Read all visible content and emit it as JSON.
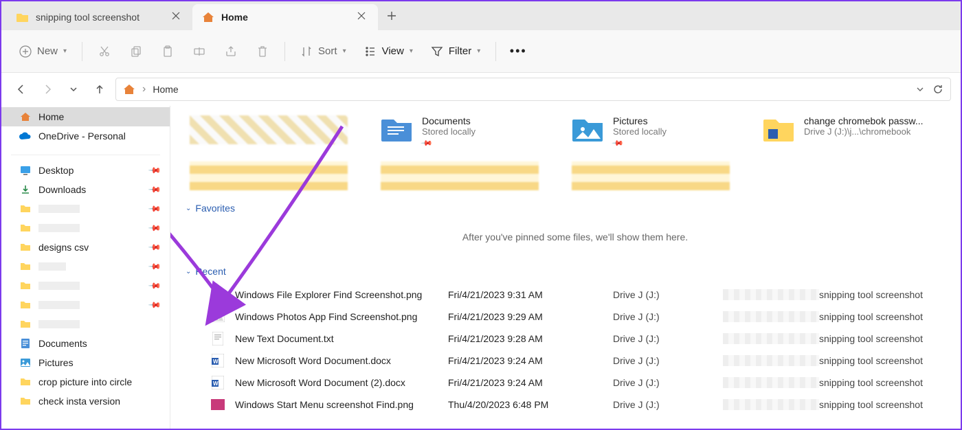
{
  "tabs": [
    {
      "label": "snipping tool screenshot",
      "active": false
    },
    {
      "label": "Home",
      "active": true
    }
  ],
  "toolbar": {
    "new": "New",
    "sort": "Sort",
    "view": "View",
    "filter": "Filter"
  },
  "breadcrumb": {
    "current": "Home",
    "sep": "›"
  },
  "sidebar": {
    "home": "Home",
    "onedrive": "OneDrive - Personal",
    "desktop": "Desktop",
    "downloads": "Downloads",
    "designs_csv": "designs csv",
    "documents": "Documents",
    "pictures": "Pictures",
    "crop": "crop picture into circle",
    "check_insta": "check insta version"
  },
  "quick": {
    "documents": {
      "title": "Documents",
      "sub": "Stored locally"
    },
    "pictures": {
      "title": "Pictures",
      "sub": "Stored locally"
    },
    "chromebook": {
      "title": "change chromebok passw...",
      "sub": "Drive J (J:)\\j...\\chromebook"
    }
  },
  "sections": {
    "favorites": "Favorites",
    "fav_empty": "After you've pinned some files, we'll show them here.",
    "recent": "Recent"
  },
  "recent": [
    {
      "name": "Windows File Explorer Find Screenshot.png",
      "date": "Fri/4/21/2023 9:31 AM",
      "loc": "Drive J (J:)",
      "path": "snipping tool screenshot",
      "icon": "img"
    },
    {
      "name": "Windows Photos App Find Screenshot.png",
      "date": "Fri/4/21/2023 9:29 AM",
      "loc": "Drive J (J:)",
      "path": "snipping tool screenshot",
      "icon": "img"
    },
    {
      "name": "New Text Document.txt",
      "date": "Fri/4/21/2023 9:28 AM",
      "loc": "Drive J (J:)",
      "path": "snipping tool screenshot",
      "icon": "txt"
    },
    {
      "name": "New Microsoft Word Document.docx",
      "date": "Fri/4/21/2023 9:24 AM",
      "loc": "Drive J (J:)",
      "path": "snipping tool screenshot",
      "icon": "doc"
    },
    {
      "name": "New Microsoft Word Document (2).docx",
      "date": "Fri/4/21/2023 9:24 AM",
      "loc": "Drive J (J:)",
      "path": "snipping tool screenshot",
      "icon": "doc"
    },
    {
      "name": "Windows Start Menu screenshot Find.png",
      "date": "Thu/4/20/2023 6:48 PM",
      "loc": "Drive J (J:)",
      "path": "snipping tool screenshot",
      "icon": "img2"
    }
  ]
}
